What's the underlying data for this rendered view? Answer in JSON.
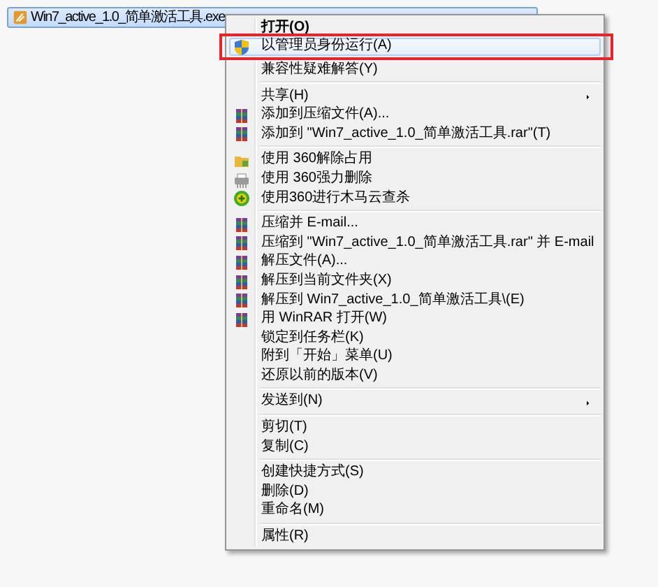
{
  "file": {
    "name": "Win7_active_1.0_简单激活工具.exe",
    "selected": true
  },
  "menu": [
    {
      "kind": "item",
      "label": "打开(O)",
      "default": true,
      "selected": false
    },
    {
      "kind": "shield",
      "label": "以管理员身份运行(A)",
      "selected": true,
      "annotated": true
    },
    {
      "kind": "item",
      "label": "兼容性疑难解答(Y)",
      "selected": false
    },
    {
      "kind": "separator"
    },
    {
      "kind": "item",
      "label": "共享(H)",
      "submenu": true,
      "selected": false
    },
    {
      "kind": "archive",
      "label": "添加到压缩文件(A)...",
      "selected": false
    },
    {
      "kind": "archive",
      "label": "添加到 \"Win7_active_1.0_简单激活工具.rar\"(T)",
      "selected": false
    },
    {
      "kind": "separator"
    },
    {
      "kind": "folder",
      "label": "使用 360解除占用",
      "selected": false
    },
    {
      "kind": "shredder",
      "label": "使用 360强力删除",
      "selected": false
    },
    {
      "kind": "scan",
      "label": "使用360进行木马云查杀",
      "selected": false
    },
    {
      "kind": "separator"
    },
    {
      "kind": "archive",
      "label": "压缩并 E-mail...",
      "selected": false
    },
    {
      "kind": "archive",
      "label": "压缩到 \"Win7_active_1.0_简单激活工具.rar\" 并 E-mail",
      "selected": false
    },
    {
      "kind": "archive",
      "label": "解压文件(A)...",
      "selected": false
    },
    {
      "kind": "archive",
      "label": "解压到当前文件夹(X)",
      "selected": false
    },
    {
      "kind": "archive",
      "label": "解压到 Win7_active_1.0_简单激活工具\\(E)",
      "selected": false
    },
    {
      "kind": "archive",
      "label": "用 WinRAR 打开(W)",
      "selected": false
    },
    {
      "kind": "item",
      "label": "锁定到任务栏(K)",
      "selected": false
    },
    {
      "kind": "item",
      "label": "附到「开始」菜单(U)",
      "selected": false
    },
    {
      "kind": "item",
      "label": "还原以前的版本(V)",
      "selected": false
    },
    {
      "kind": "separator"
    },
    {
      "kind": "item",
      "label": "发送到(N)",
      "submenu": true,
      "selected": false
    },
    {
      "kind": "separator"
    },
    {
      "kind": "item",
      "label": "剪切(T)",
      "selected": false
    },
    {
      "kind": "item",
      "label": "复制(C)",
      "selected": false
    },
    {
      "kind": "separator"
    },
    {
      "kind": "item",
      "label": "创建快捷方式(S)",
      "selected": false
    },
    {
      "kind": "item",
      "label": "删除(D)",
      "selected": false
    },
    {
      "kind": "item",
      "label": "重命名(M)",
      "selected": false
    },
    {
      "kind": "separator"
    },
    {
      "kind": "item",
      "label": "属性(R)",
      "selected": false
    }
  ]
}
